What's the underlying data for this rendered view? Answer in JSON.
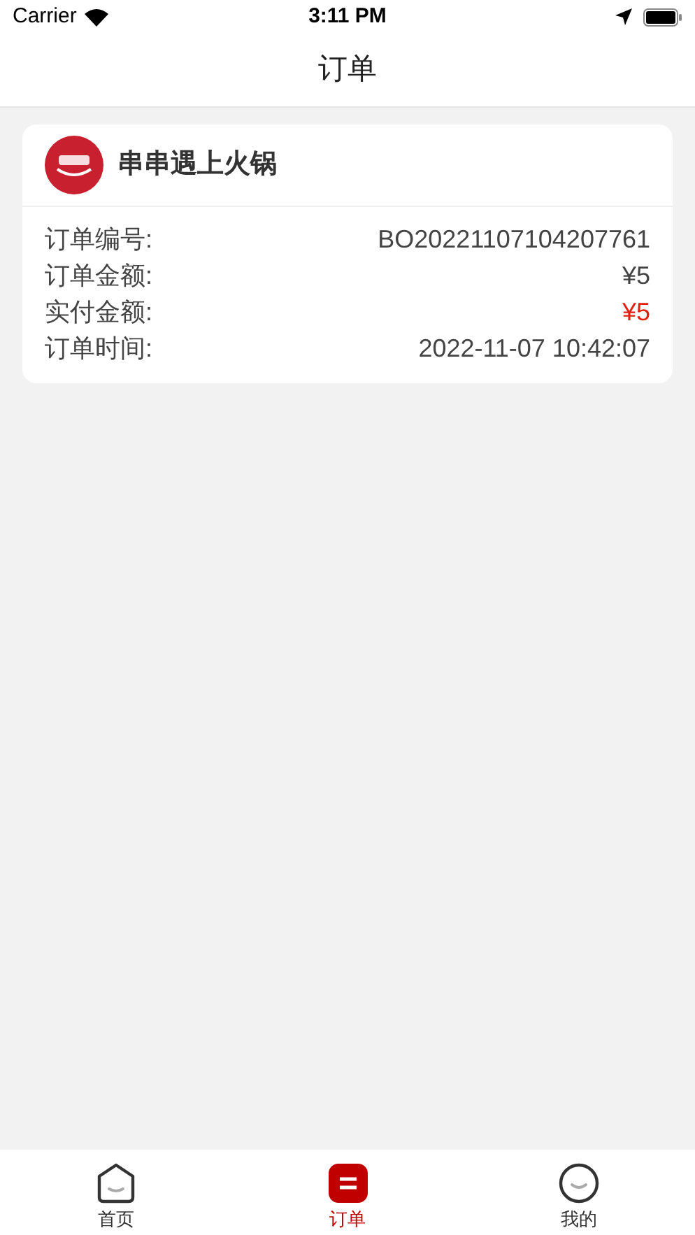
{
  "status_bar": {
    "carrier": "Carrier",
    "time": "3:11 PM"
  },
  "nav": {
    "title": "订单"
  },
  "orders": [
    {
      "store": "串串遇上火锅",
      "rows": [
        {
          "label": "订单编号:",
          "value": "BO20221107104207761",
          "highlighted": false
        },
        {
          "label": "订单金额:",
          "value": "¥5",
          "highlighted": false
        },
        {
          "label": "实付金额:",
          "value": "¥5",
          "highlighted": true
        },
        {
          "label": "订单时间:",
          "value": "2022-11-07 10:42:07",
          "highlighted": false
        }
      ]
    }
  ],
  "tab_bar": [
    {
      "kind": "home",
      "label": "首页",
      "selected": false
    },
    {
      "kind": "orders",
      "label": "订单",
      "selected": true
    },
    {
      "kind": "profile",
      "label": "我的",
      "selected": false
    }
  ]
}
